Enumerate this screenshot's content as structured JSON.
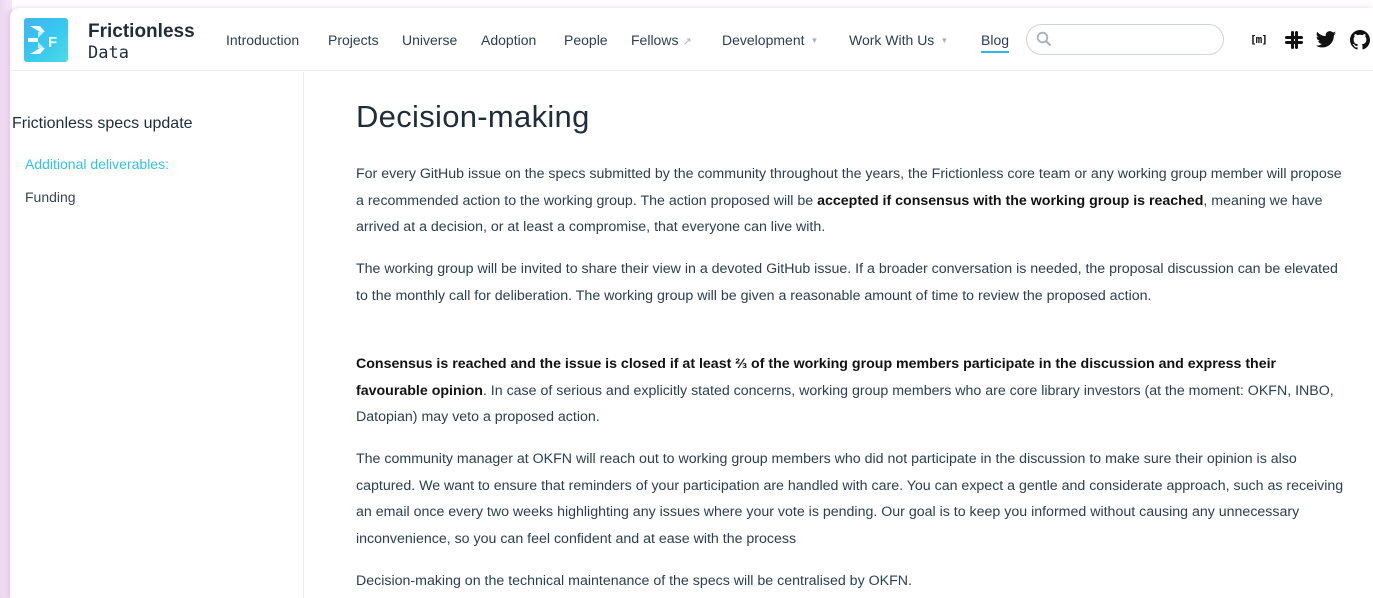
{
  "brand": {
    "name_top": "Frictionless",
    "name_bottom": "Data",
    "logo_letter": "F",
    "colors": {
      "logo_start": "#3fb4f0",
      "logo_end": "#4cdbe4",
      "accent": "#35c0e8"
    }
  },
  "nav": {
    "items": [
      {
        "label": "Introduction"
      },
      {
        "label": "Projects"
      },
      {
        "label": "Universe"
      },
      {
        "label": "Adoption"
      },
      {
        "label": "People"
      },
      {
        "label": "Fellows",
        "icon": "external-link-icon"
      },
      {
        "label": "Development",
        "icon": "caret-down-icon"
      },
      {
        "label": "Work With Us",
        "icon": "caret-down-icon"
      },
      {
        "label": "Blog",
        "active": true
      }
    ],
    "search": {
      "value": "",
      "placeholder": "",
      "icon": "search-icon"
    },
    "social": {
      "matrix_label": "[m]",
      "icons": [
        "matrix-icon",
        "slack-icon",
        "twitter-icon",
        "github-icon"
      ]
    }
  },
  "sidebar": {
    "title": "Frictionless specs update",
    "items": [
      {
        "label": "Additional deliverables:",
        "active": true
      },
      {
        "label": "Funding",
        "active": false
      }
    ]
  },
  "main": {
    "heading": "Decision-making",
    "paragraphs": [
      {
        "p1": "For every GitHub issue on the specs submitted by the community throughout the years, the Frictionless core team or any working group member will propose a recommended action to the working group. The action proposed will be ",
        "bold": "accepted if consensus with the working group is reached",
        "p2": ", meaning we have arrived at a decision, or at least a compromise, that everyone can live with."
      },
      {
        "p1": "The working group will be invited to share their view in a devoted GitHub issue. If a broader conversation is needed, the proposal discussion can be elevated to the monthly call for deliberation. The working group will be given a reasonable amount of time to review the proposed action."
      },
      {
        "bold": "Consensus is reached and the issue is closed if at least ⅔ of the working group members participate in the discussion and express their favourable opinion",
        "p2": ". In case of serious and explicitly stated concerns, working group members who are core library investors (at the moment: OKFN, INBO, Datopian) may veto a proposed action."
      },
      {
        "p1": "The community manager at OKFN will reach out to working group members who did not participate in the discussion to make sure their opinion is also captured. We want to ensure that reminders of your participation are handled with care. You can expect a gentle and considerate approach, such as receiving an email once every two weeks highlighting any issues where your vote is pending. Our goal is to keep you informed without causing any unnecessary inconvenience, so you can feel confident and at ease with the process"
      },
      {
        "p1": "Decision-making on the technical maintenance of the specs will be centralised by OKFN."
      }
    ]
  }
}
